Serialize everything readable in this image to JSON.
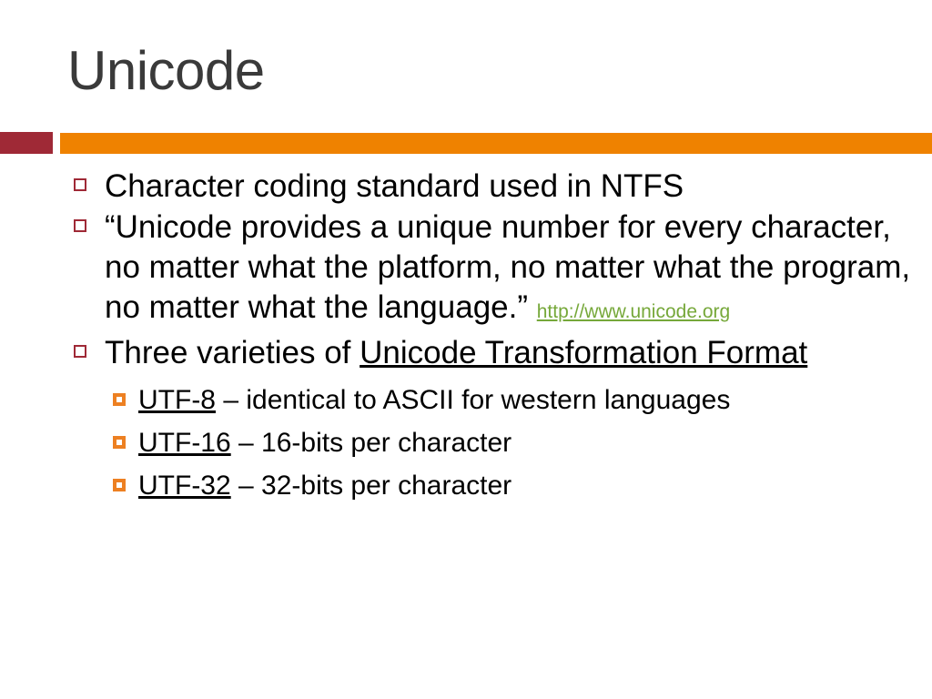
{
  "slide": {
    "title": "Unicode",
    "colors": {
      "title_text": "#3a3a3a",
      "accent_bar": "#9f2936",
      "main_bar": "#ef8200",
      "level1_bullet": "#9f2936",
      "level2_bullet": "#ed8022",
      "hyperlink": "#76a83a",
      "body_text": "#000000",
      "background": "#ffffff"
    },
    "bullets": [
      {
        "level": 1,
        "marker": "hollow-square-marker",
        "text": "Character coding standard used in NTFS"
      },
      {
        "level": 1,
        "marker": "hollow-square-marker",
        "text": "“Unicode provides a unique number for every character, no matter what the platform, no matter what the program, no matter what the language.” ",
        "link_text": "http://www.unicode.org"
      },
      {
        "level": 1,
        "marker": "hollow-square-marker",
        "text_plain": "Three varieties of ",
        "text_underlined": "Unicode Transformation Format"
      },
      {
        "level": 2,
        "marker": "orange-square-marker",
        "term": "UTF-8",
        "description": " – identical to ASCII for western languages"
      },
      {
        "level": 2,
        "marker": "orange-square-marker",
        "term": "UTF-16",
        "description": " – 16-bits per character"
      },
      {
        "level": 2,
        "marker": "orange-square-marker",
        "term": "UTF-32",
        "description": " – 32-bits per character"
      }
    ]
  }
}
